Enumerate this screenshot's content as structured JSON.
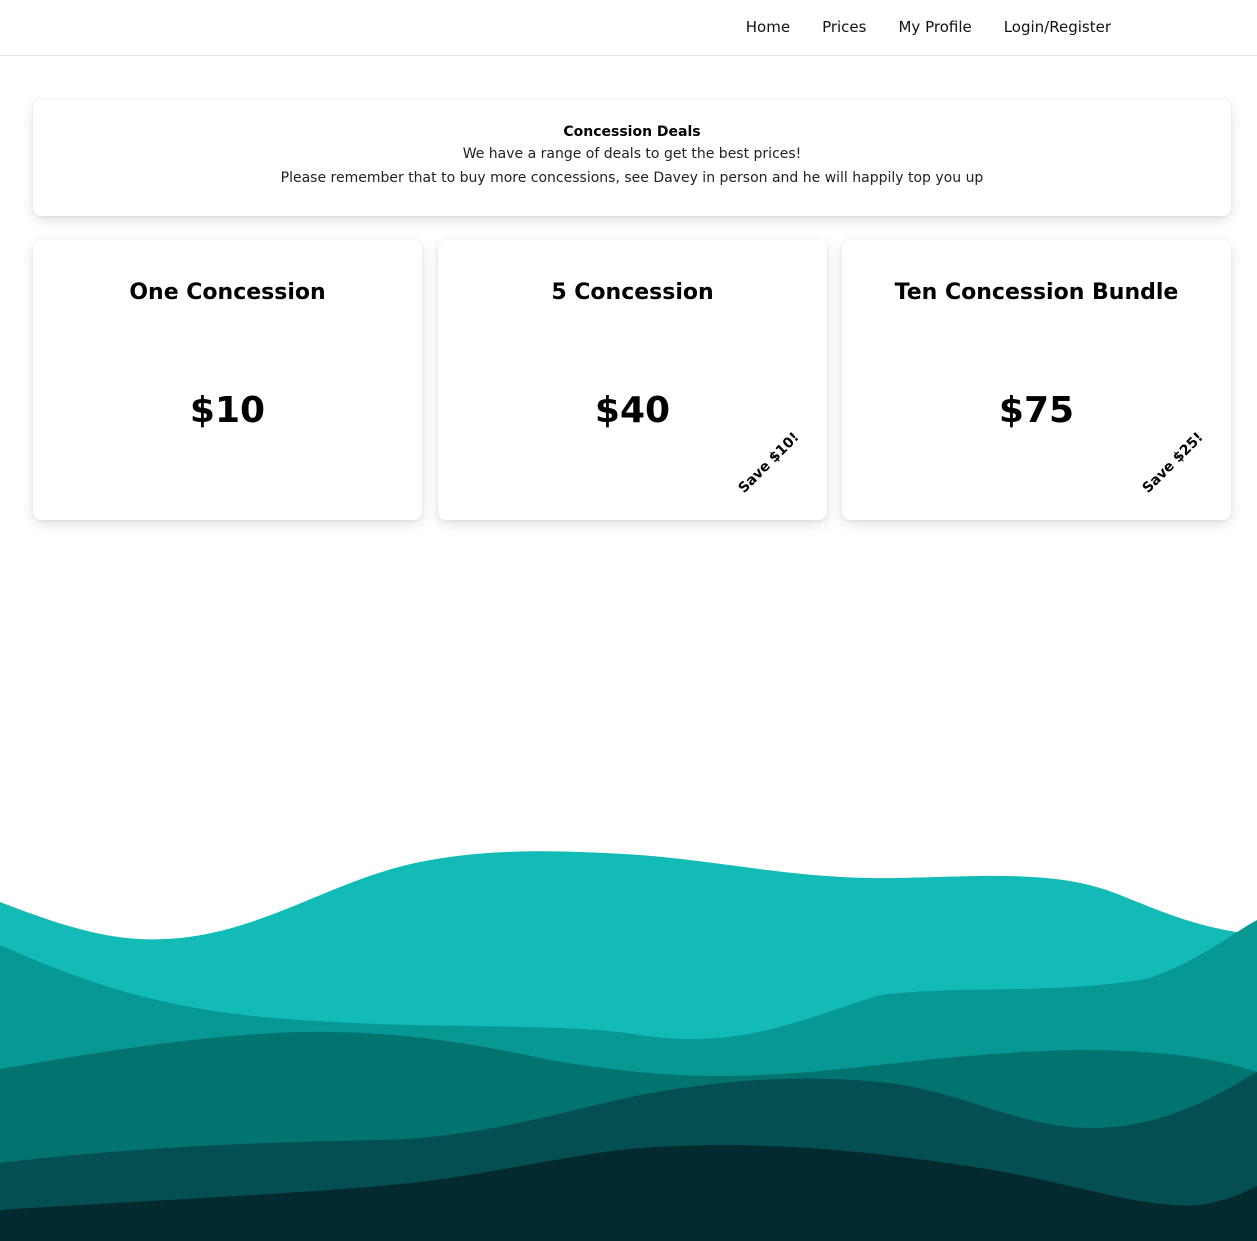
{
  "nav": {
    "links": [
      "Home",
      "Prices",
      "My Profile",
      "Login/Register"
    ]
  },
  "info": {
    "title": "Concession Deals",
    "line1": "We have a range of deals to get the best prices!",
    "line2": "Please remember that to buy more concessions, see Davey in person and he will happily top you up"
  },
  "cards": [
    {
      "title": "One Concession",
      "price": "$10",
      "save": ""
    },
    {
      "title": "5 Concession",
      "price": "$40",
      "save": "Save $10!"
    },
    {
      "title": "Ten Concession Bundle",
      "price": "$75",
      "save": "Save $25!"
    }
  ],
  "colors": {
    "wave1": "#13bbb7",
    "wave2": "#079894",
    "wave3": "#027470",
    "wave4": "#044f52",
    "wave5": "#032b2f"
  }
}
